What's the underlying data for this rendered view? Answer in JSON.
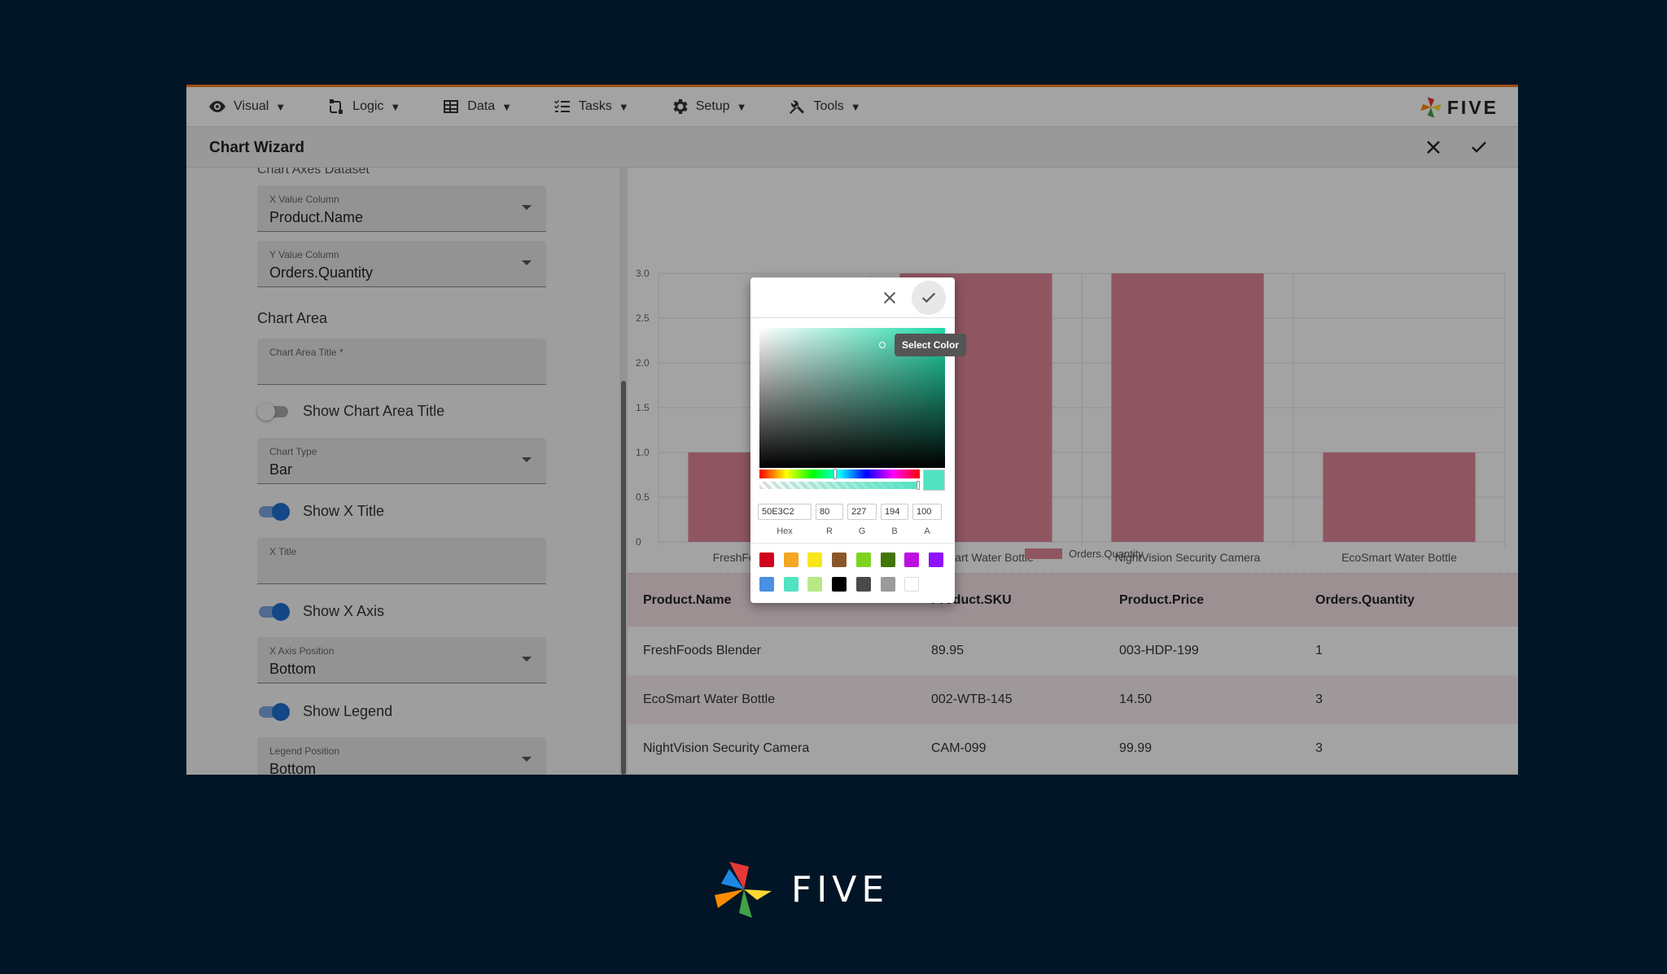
{
  "menu": [
    {
      "label": "Visual",
      "icon": "eye-icon"
    },
    {
      "label": "Logic",
      "icon": "logic-icon"
    },
    {
      "label": "Data",
      "icon": "table-icon"
    },
    {
      "label": "Tasks",
      "icon": "tasks-icon"
    },
    {
      "label": "Setup",
      "icon": "gear-icon"
    },
    {
      "label": "Tools",
      "icon": "tools-icon"
    }
  ],
  "menu_caret": "▼",
  "brand": {
    "word": "FIVE"
  },
  "wizard": {
    "title": "Chart Wizard"
  },
  "form": {
    "cut_heading": "Chart Axes Dataset",
    "x_value_column": {
      "label": "X Value Column",
      "value": "Product.Name"
    },
    "y_value_column": {
      "label": "Y Value Column",
      "value": "Orders.Quantity"
    },
    "chart_area_heading": "Chart Area",
    "chart_area_title": {
      "label": "Chart Area Title *",
      "value": ""
    },
    "show_chart_area_title": {
      "label": "Show Chart Area Title",
      "on": false
    },
    "chart_type": {
      "label": "Chart Type",
      "value": "Bar"
    },
    "show_x_title": {
      "label": "Show X Title",
      "on": true
    },
    "x_title": {
      "label": "X Title",
      "value": ""
    },
    "show_x_axis": {
      "label": "Show X Axis",
      "on": true
    },
    "x_axis_position": {
      "label": "X Axis Position",
      "value": "Bottom"
    },
    "show_legend": {
      "label": "Show Legend",
      "on": true
    },
    "legend_position": {
      "label": "Legend Position",
      "value": "Bottom"
    }
  },
  "chart_data": {
    "type": "bar",
    "categories": [
      "FreshFoods Blender",
      "EcoSmart Water Bottle",
      "NightVision Security Camera",
      "EcoSmart Water Bottle"
    ],
    "series": [
      {
        "name": "Orders.Quantity",
        "values": [
          1,
          3,
          3,
          1
        ],
        "color": "#e0879a"
      }
    ],
    "ylim": [
      0,
      3
    ],
    "yticks": [
      "0",
      "0.5",
      "1.0",
      "1.5",
      "2.0",
      "2.5",
      "3.0"
    ],
    "legend": "bottom",
    "grid": true
  },
  "table": {
    "columns": [
      "Product.Name",
      "Product.SKU",
      "Product.Price",
      "Orders.Quantity"
    ],
    "rows": [
      [
        "FreshFoods Blender",
        "89.95",
        "003-HDP-199",
        "1"
      ],
      [
        "EcoSmart Water Bottle",
        "002-WTB-145",
        "14.50",
        "3"
      ],
      [
        "NightVision Security Camera",
        "CAM-099",
        "99.99",
        "3"
      ]
    ]
  },
  "color_picker": {
    "tooltip": "Select Color",
    "current_color": "#50E3C2",
    "hex": "50E3C2",
    "r": "80",
    "g": "227",
    "b": "194",
    "a": "100",
    "labels": {
      "hex": "Hex",
      "r": "R",
      "g": "G",
      "b": "B",
      "a": "A"
    },
    "swatches": [
      "#D0021B",
      "#F5A623",
      "#F8E71C",
      "#8B572A",
      "#7ED321",
      "#417505",
      "#BD10E0",
      "#9013FE",
      "#4A90E2",
      "#50E3C2",
      "#B8E986",
      "#000000",
      "#4A4A4A",
      "#9B9B9B",
      "#FFFFFF"
    ]
  }
}
